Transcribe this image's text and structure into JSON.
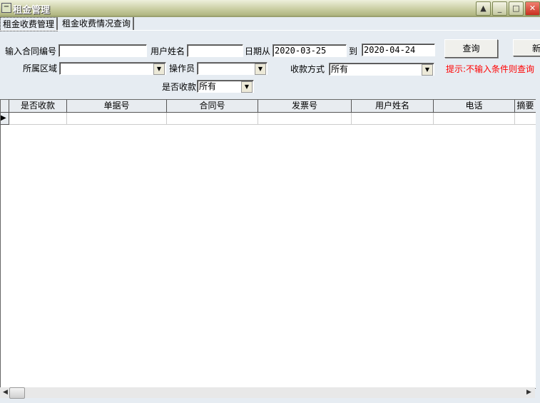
{
  "window": {
    "title": "租金管理"
  },
  "tabs": [
    {
      "label": "租金收费管理"
    },
    {
      "label": "租金收费情况查询"
    }
  ],
  "form": {
    "contract_no_label": "输入合同编号",
    "contract_no_value": "",
    "user_name_label": "用户姓名",
    "user_name_value": "",
    "date_from_label": "日期从",
    "date_from_value": "2020-03-25",
    "date_to_label": "到",
    "date_to_value": "2020-04-24",
    "region_label": "所属区域",
    "region_value": "",
    "operator_label": "操作员",
    "operator_value": "",
    "payment_method_label": "收款方式",
    "payment_method_value": "所有",
    "paid_label": "是否收款",
    "paid_value": "所有",
    "query_button": "查询",
    "new_button": "新",
    "hint": "提示:不输入条件则查询"
  },
  "grid": {
    "columns": [
      "是否收款",
      "单据号",
      "合同号",
      "发票号",
      "用户姓名",
      "电话",
      "摘要"
    ]
  }
}
